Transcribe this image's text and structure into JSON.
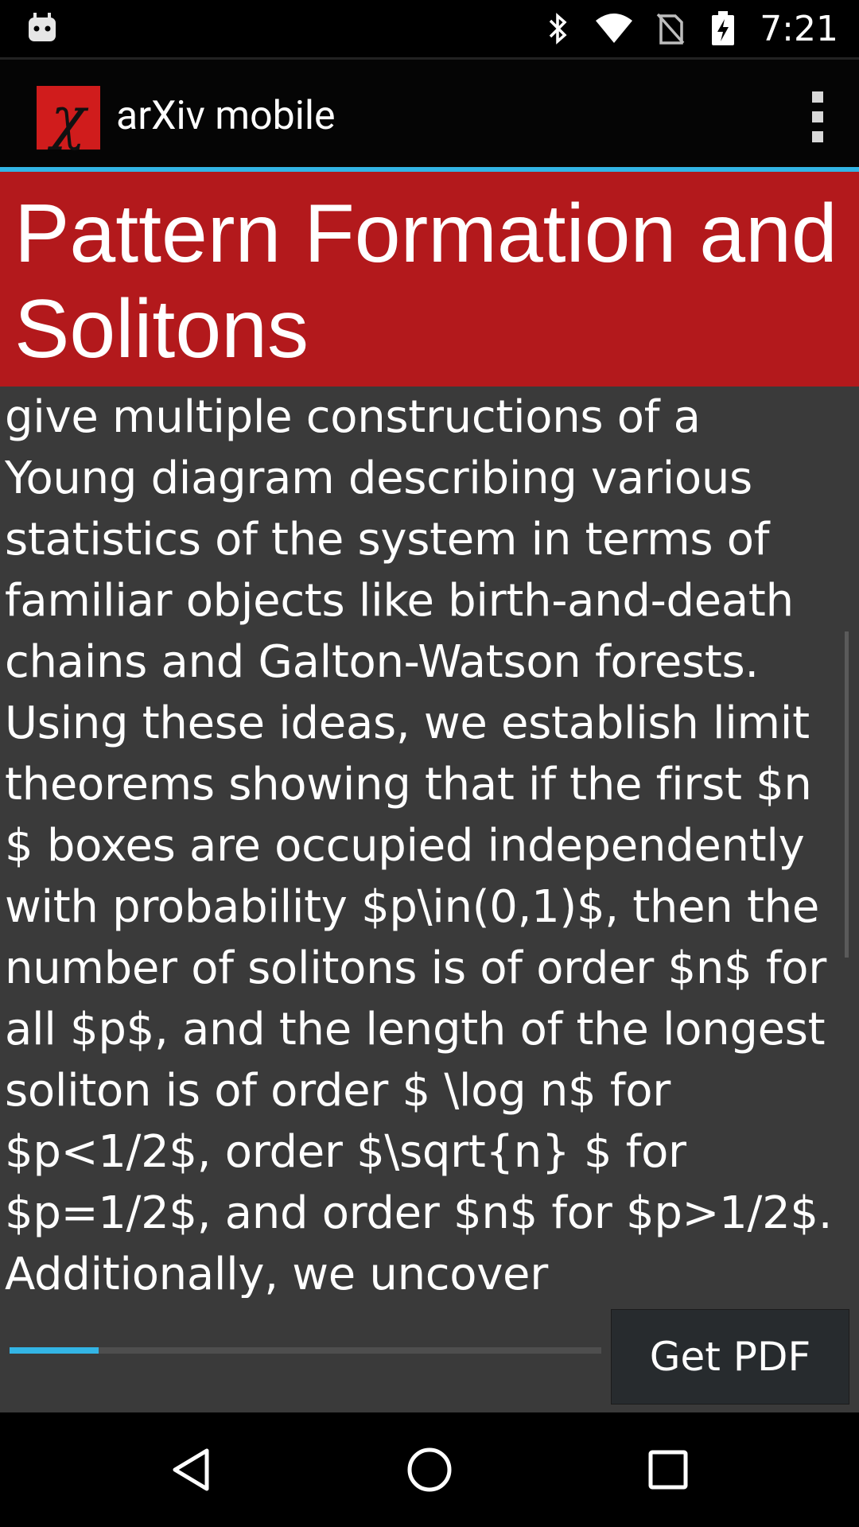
{
  "status_bar": {
    "time": "7:21",
    "icons": [
      "android-debug-icon",
      "bluetooth-icon",
      "wifi-icon",
      "no-sim-icon",
      "battery-charging-icon"
    ]
  },
  "action_bar": {
    "app_title": "arXiv mobile",
    "logo_glyph": "χ",
    "overflow_icon": "overflow-menu-icon"
  },
  "paper": {
    "title": "Pattern Formation and Solitons",
    "abstract_visible": "give multiple constructions of a Young diagram describing various statistics of the system in terms of familiar objects like birth-and-death chains and Galton-Watson forests. Using these ideas, we establish limit theorems showing that if the first $n $ boxes are occupied independently with probability $p\\in(0,1)$, then the number of solitons is of order $n$ for all $p$, and the length of the longest soliton is of order $ \\log n$ for $p<1/2$, order $\\sqrt{n} $ for $p=1/2$, and order $n$ for $p>1/2$. Additionally, we uncover"
  },
  "download": {
    "progress": 0.15,
    "button_label": "Get PDF"
  },
  "nav_bar": {
    "buttons": [
      "back-icon",
      "home-icon",
      "recents-icon"
    ]
  },
  "colors": {
    "accent": "#33b5e5",
    "banner": "#b3191c",
    "background": "#3a3a3a"
  }
}
